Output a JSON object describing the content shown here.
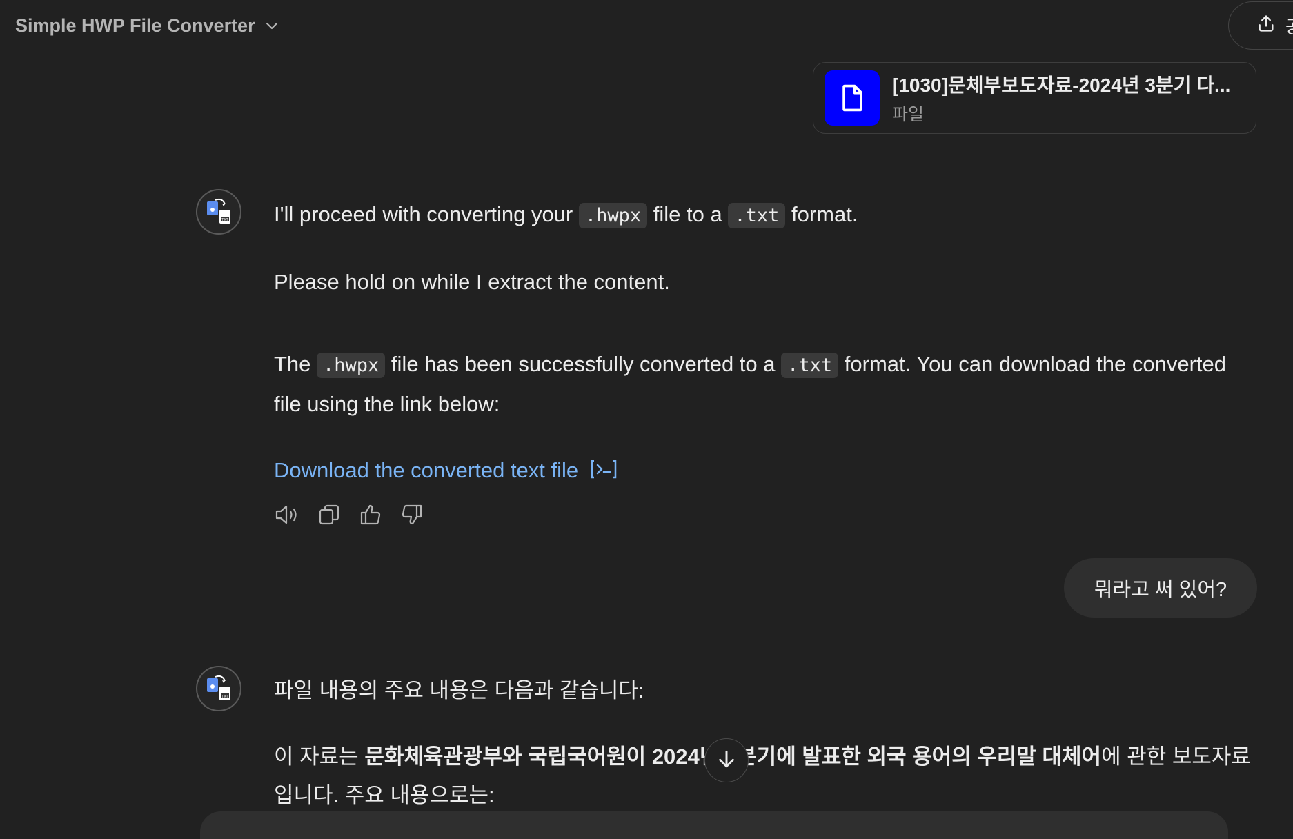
{
  "header": {
    "title": "Simple HWP File Converter",
    "share_label": "공유"
  },
  "attachment": {
    "name": "[1030]문체부보도자료-2024년 3분기 다...",
    "type": "파일"
  },
  "assistant_message_1": {
    "line1_a": "I'll proceed with converting your ",
    "code1": ".hwpx",
    "line1_b": " file to a ",
    "code2": ".txt",
    "line1_c": " format.",
    "line2": "Please hold on while I extract the content.",
    "line3_a": "The ",
    "code3": ".hwpx",
    "line3_b": " file has been successfully converted to a ",
    "code4": ".txt",
    "line3_c": " format. You can download the converted file using the link below:",
    "download_link": "Download the converted text file"
  },
  "user_message": {
    "text": "뭐라고 써 있어?"
  },
  "assistant_message_2": {
    "intro": "파일 내용의 주요 내용은 다음과 같습니다:",
    "body_a": "이 자료는 ",
    "body_bold": "문화체육관광부와 국립국어원이 2024년 3분기에 발표한 외국 용어의 우리말 대체어",
    "body_b": "에 관한 보도자료입니다. 주요 내용으로는:"
  },
  "icons": [
    "chevron-down-icon",
    "share-icon",
    "file-icon",
    "converter-avatar-icon",
    "speaker-icon",
    "copy-icon",
    "thumbs-up-icon",
    "thumbs-down-icon",
    "code-interpreter-icon",
    "arrow-down-icon"
  ]
}
